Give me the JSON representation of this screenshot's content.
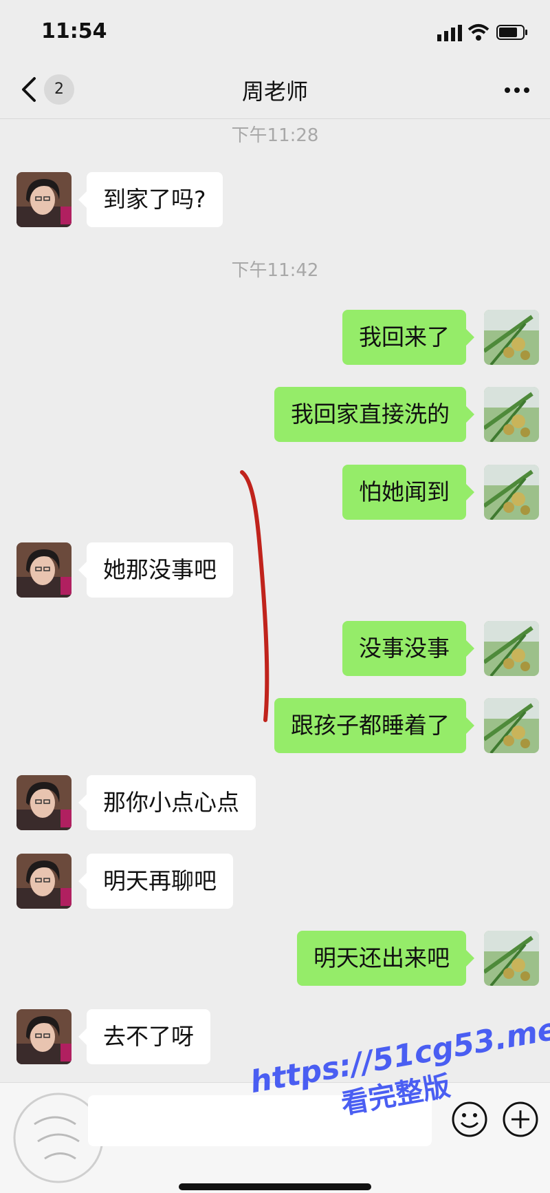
{
  "status_bar": {
    "time": "11:54"
  },
  "nav": {
    "unread_count": "2",
    "title": "周老师"
  },
  "messages": [
    {
      "type": "time",
      "text": "下午11:28"
    },
    {
      "type": "in",
      "text": "到家了吗?"
    },
    {
      "type": "time",
      "text": "下午11:42"
    },
    {
      "type": "out",
      "text": "我回来了"
    },
    {
      "type": "out",
      "text": "我回家直接洗的"
    },
    {
      "type": "out",
      "text": "怕她闻到"
    },
    {
      "type": "in",
      "text": "她那没事吧"
    },
    {
      "type": "out",
      "text": "没事没事"
    },
    {
      "type": "out",
      "text": "跟孩子都睡着了"
    },
    {
      "type": "in",
      "text": "那你小点心点"
    },
    {
      "type": "in",
      "text": "明天再聊吧"
    },
    {
      "type": "out",
      "text": "明天还出来吧"
    },
    {
      "type": "in",
      "text": "去不了呀"
    }
  ],
  "watermark": {
    "url": "https://51cg53.me",
    "subtitle": "看完整版"
  },
  "colors": {
    "incoming_bubble": "#ffffff",
    "outgoing_bubble": "#95ec69",
    "background": "#ededed",
    "annotation": "#c0231c",
    "watermark": "#4a5ef2"
  },
  "icons": [
    "back-icon",
    "more-icon",
    "emoji-icon",
    "plus-icon",
    "signal-icon",
    "wifi-icon",
    "battery-icon",
    "voice-icon"
  ]
}
